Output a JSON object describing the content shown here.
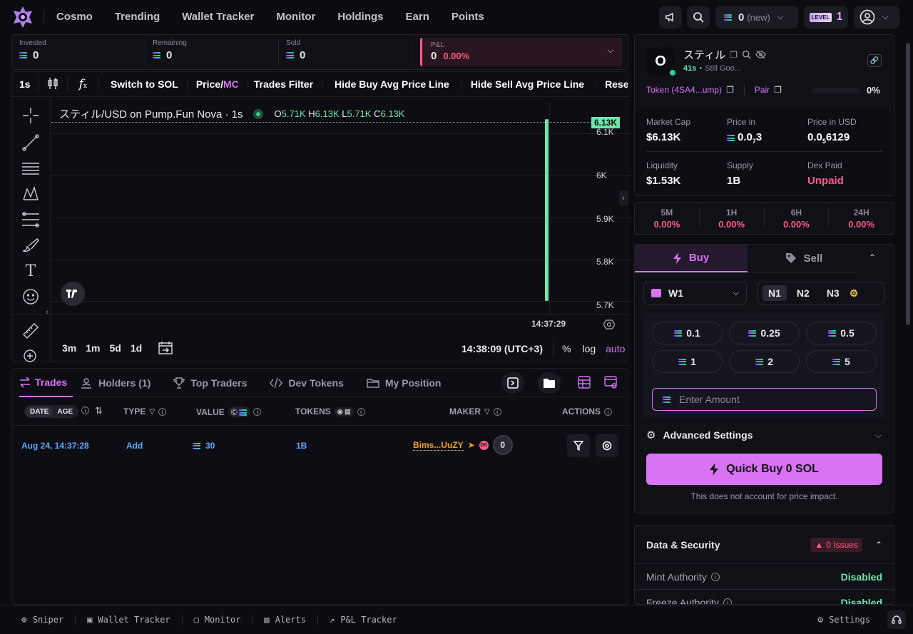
{
  "nav": {
    "items": [
      "Cosmo",
      "Trending",
      "Wallet Tracker",
      "Monitor",
      "Holdings",
      "Earn",
      "Points"
    ],
    "balance": "0",
    "balance_note": "(new)",
    "level_label": "LEVEL",
    "level_value": "1"
  },
  "stats": {
    "invested_label": "Invested",
    "invested": "0",
    "remaining_label": "Remaining",
    "remaining": "0",
    "sold_label": "Sold",
    "sold": "0",
    "pnl_label": "P&L",
    "pnl": "0",
    "pnl_pct": "0.00%"
  },
  "chart_toolbar": {
    "interval": "1s",
    "fx": "f",
    "switch": "Switch to SOL",
    "price": "Price/",
    "mc": "MC",
    "filter": "Trades Filter",
    "hide_buy": "Hide Buy Avg Price Line",
    "hide_sell": "Hide Sell Avg Price Line",
    "reset": "Rese"
  },
  "chart": {
    "symbol": "スティル/USD on Pump.Fun Nova · 1s",
    "o_label": "O",
    "o": "5.71K",
    "h_label": "H",
    "h": "6.13K",
    "l_label": "L",
    "l": "5.71K",
    "c_label": "C",
    "c": "6.13K",
    "last_price_tag": "6.13K",
    "time_label": "14:37:29",
    "clock": "14:38:09 (UTC+3)",
    "ranges": [
      "3m",
      "1m",
      "5d",
      "1d"
    ],
    "pct": "%",
    "log": "log",
    "auto": "auto"
  },
  "chart_data": {
    "type": "bar",
    "title": "スティル/USD on Pump.Fun Nova · 1s",
    "ylim": [
      5.68,
      6.17
    ],
    "yticks": [
      {
        "label": "6.1K",
        "value": 6.1
      },
      {
        "label": "6K",
        "value": 6.0
      },
      {
        "label": "5.9K",
        "value": 5.9
      },
      {
        "label": "5.8K",
        "value": 5.8
      },
      {
        "label": "5.7K",
        "value": 5.7
      }
    ],
    "candles": [
      {
        "time": "14:37:29",
        "open": 5.71,
        "high": 6.13,
        "low": 5.71,
        "close": 6.13
      }
    ],
    "grid": true
  },
  "bottom_tabs": {
    "trades": "Trades",
    "holders": "Holders (1)",
    "top_traders": "Top Traders",
    "dev_tokens": "Dev Tokens",
    "my_position": "My Position"
  },
  "table": {
    "headers": {
      "date": "DATE",
      "age": "AGE",
      "type": "TYPE",
      "value": "VALUE",
      "tokens": "TOKENS",
      "maker": "MAKER",
      "actions": "ACTIONS"
    },
    "rows": [
      {
        "date": "Aug 24, 14:37:28",
        "type": "Add",
        "value": "30",
        "tokens": "1B",
        "maker": "Bims...UuZY",
        "badge": "DS",
        "count": "0"
      }
    ]
  },
  "token": {
    "avatar_letter": "O",
    "name": "スティル",
    "age": "41s",
    "desc": "Still Goo...",
    "ca": "Token (4SA4...ump)",
    "pair": "Pair",
    "pct": "0%"
  },
  "token_stats": {
    "mcap_label": "Market Cap",
    "mcap": "$6.13K",
    "price_in_label": "Price in",
    "price_in_pre": "0.0",
    "price_in_sub": "7",
    "price_in_post": "3",
    "price_usd_label": "Price in USD",
    "price_usd_pre": "0.0",
    "price_usd_sub": "5",
    "price_usd_post": "6129",
    "liq_label": "Liquidity",
    "liq": "$1.53K",
    "supply_label": "Supply",
    "supply": "1B",
    "dex_label": "Dex Paid",
    "dex": "Unpaid"
  },
  "timeframes": [
    {
      "label": "5M",
      "value": "0.00%"
    },
    {
      "label": "1H",
      "value": "0.00%"
    },
    {
      "label": "6H",
      "value": "0.00%"
    },
    {
      "label": "24H",
      "value": "0.00%"
    }
  ],
  "trade": {
    "buy": "Buy",
    "sell": "Sell",
    "wallet": "W1",
    "presets": [
      "N1",
      "N2",
      "N3"
    ],
    "amounts": [
      "0.1",
      "0.25",
      "0.5",
      "1",
      "2",
      "5"
    ],
    "amount_placeholder": "Enter Amount",
    "advanced": "Advanced Settings",
    "quick_buy": "Quick Buy 0 SOL",
    "note": "This does not account for price impact."
  },
  "security": {
    "title": "Data & Security",
    "issues": "0 Issues",
    "mint_label": "Mint Authority",
    "mint": "Disabled",
    "freeze_label": "Freeze Authority",
    "freeze": "Disabled"
  },
  "footer": {
    "sniper": "Sniper",
    "wallet_tracker": "Wallet Tracker",
    "monitor": "Monitor",
    "alerts": "Alerts",
    "pnl": "P&L Tracker",
    "settings": "Settings"
  },
  "colors": {
    "accent": "#d873f5",
    "positive": "#6ee7a8",
    "negative": "#ff5a8a",
    "link": "#5aa7ff"
  }
}
